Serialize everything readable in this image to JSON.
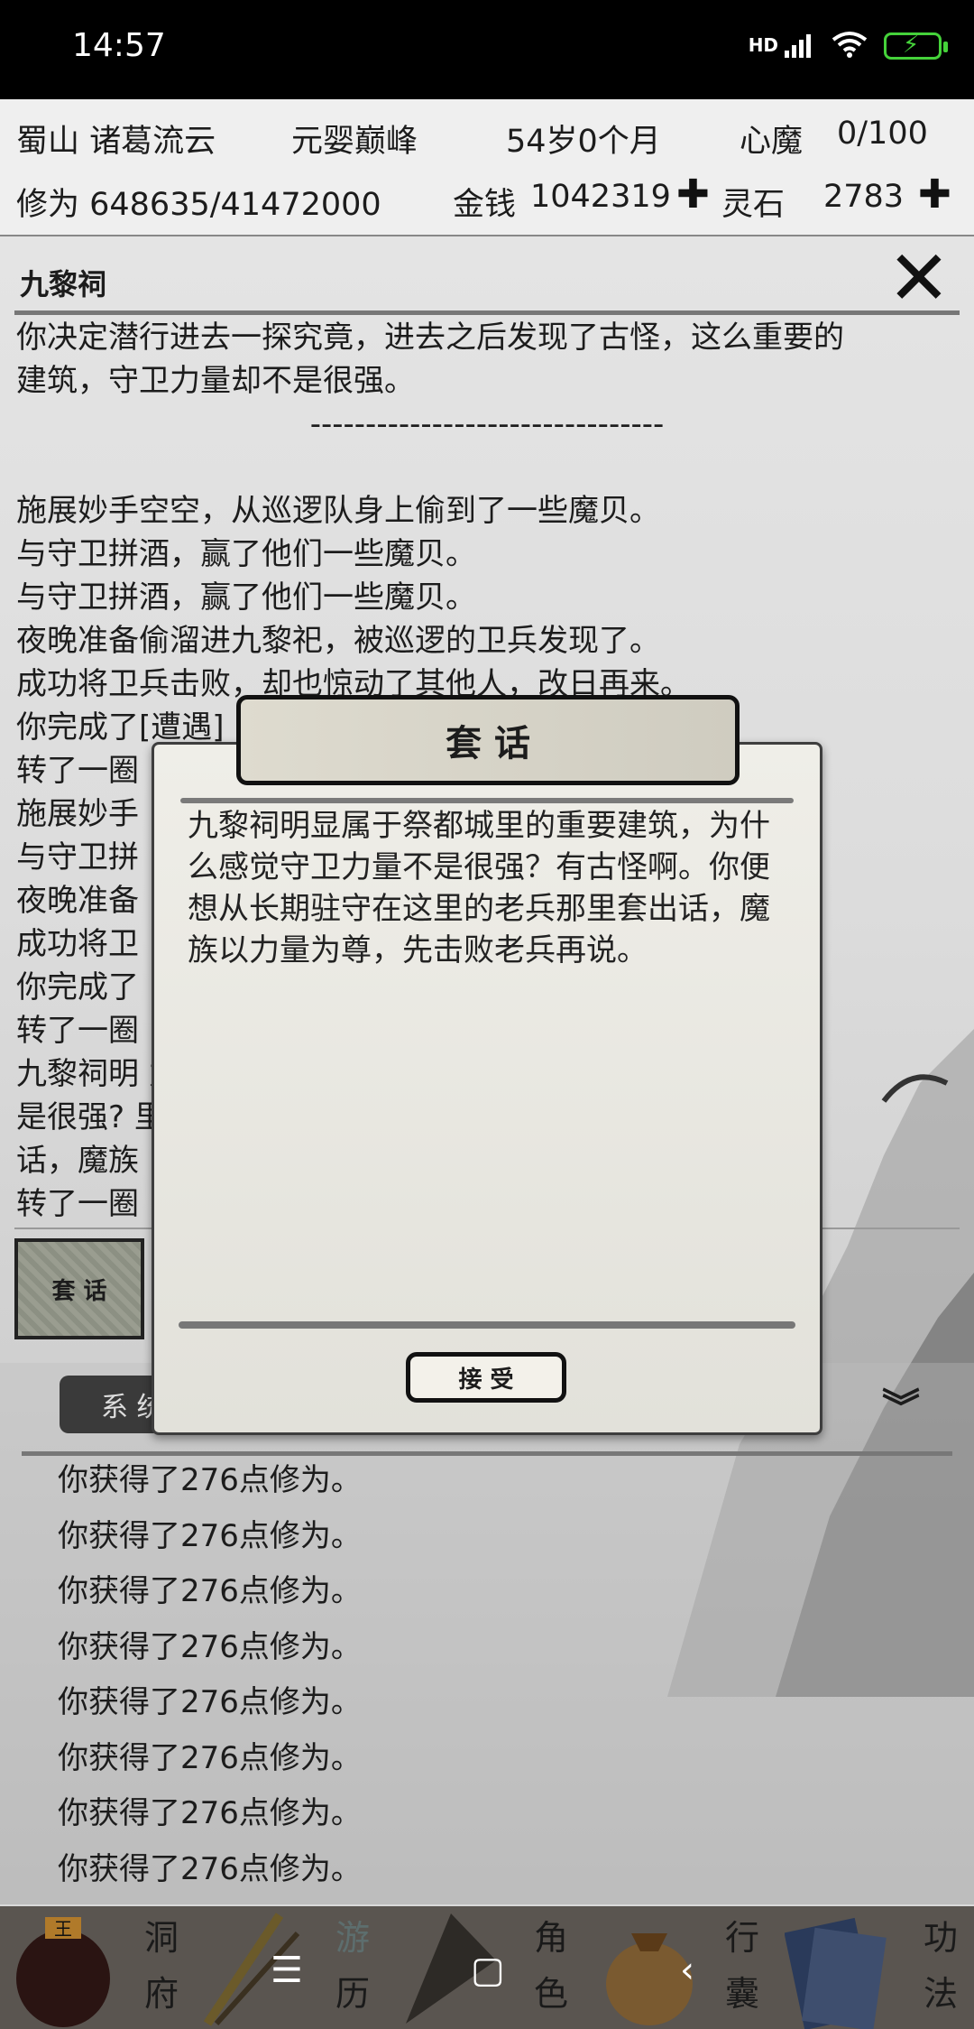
{
  "statusbar": {
    "time": "14:57",
    "signal_label": "HD"
  },
  "header": {
    "sect": "蜀山 诸葛流云",
    "realm": "元婴巅峰",
    "age": "54岁0个月",
    "demon_label": "心魔",
    "demon_value": "0/100",
    "cultivation": "修为 648635/41472000",
    "money_label": "金钱",
    "money_value": "1042319",
    "stone_label": "灵石",
    "stone_value": "2783"
  },
  "location": {
    "title": "九黎祠"
  },
  "story": [
    "你决定潜行进去一探究竟，进去之后发现了古怪，这么重要的",
    "建筑，守卫力量却不是很强。",
    "--------------------------------",
    "",
    "施展妙手空空，从巡逻队身上偷到了一些魔贝。",
    "与守卫拼酒，赢了他们一些魔贝。",
    "与守卫拼酒，赢了他们一些魔贝。",
    "夜晚准备偷溜进九黎祀，被巡逻的卫兵发现了。",
    "成功将卫兵击败，却也惊动了其他人，改日再来。",
    "你完成了[遭遇]",
    "转了一圈",
    "施展妙手",
    "与守卫拼",
    "夜晚准备",
    "成功将卫",
    "你完成了",
    "转了一圈",
    "九黎祠明                                           力量不",
    "是很强?                                            里套出",
    "话，魔族",
    "转了一圈"
  ],
  "side_button": "套 话",
  "log": {
    "tab_label": "系 统",
    "items": [
      "你获得了276点修为。",
      "你获得了276点修为。",
      "你获得了276点修为。",
      "你获得了276点修为。",
      "你获得了276点修为。",
      "你获得了276点修为。",
      "你获得了276点修为。",
      "你获得了276点修为。"
    ]
  },
  "dialog": {
    "title": "套 话",
    "body": "九黎祠明显属于祭都城里的重要建筑，为什么感觉守卫力量不是很强？有古怪啊。你便想从长期驻守在这里的老兵那里套出话，魔族以力量为尊，先击败老兵再说。",
    "accept": "接 受"
  },
  "nav": {
    "items": [
      {
        "top": "洞",
        "bottom": "府"
      },
      {
        "top": "游",
        "bottom": "历"
      },
      {
        "top": "角",
        "bottom": "色"
      },
      {
        "top": "行",
        "bottom": "囊"
      },
      {
        "top": "功",
        "bottom": "法"
      }
    ],
    "badge": "王"
  },
  "colors": {
    "battery": "#45d23a",
    "status_bg": "#000000",
    "nav_bg": "#5a5550"
  }
}
